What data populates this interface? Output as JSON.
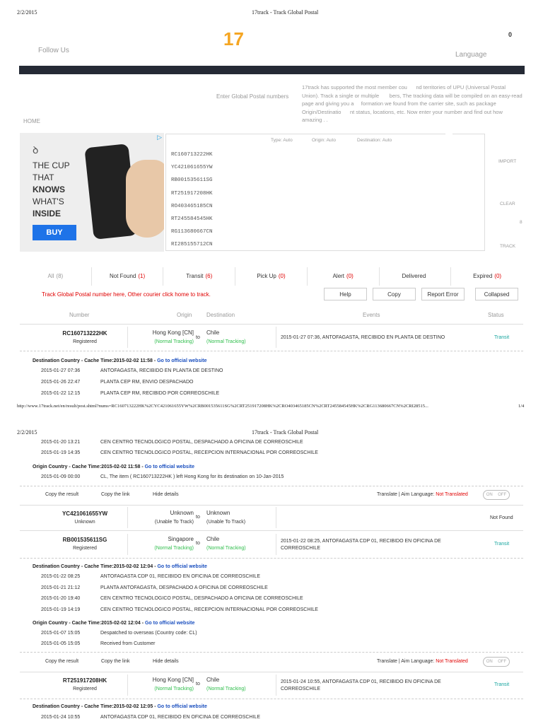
{
  "page1": {
    "print_date": "2/2/2015",
    "print_title": "17track - Track Global Postal",
    "follow_us": "Follow Us",
    "logo": "17",
    "cart_count": "0",
    "language": "Language",
    "home": "HOME",
    "enter_label": "Enter Global Postal numbers",
    "intro": "17track has supported the most member cou      nd territories of UPU (Universal Postal Union). Track a single or multiple       bers, The tracking data will be compiled on an easy-read page and giving you a     formation we found from the carrier site, such as package Origin/Destinatio      nt status, locations, etc. Now enter your number and find out how amazing . .",
    "ad": {
      "line1": "THE CUP",
      "line2": "THAT",
      "line3": "KNOWS",
      "line4": "WHAT'S",
      "line5": "INSIDE",
      "buy": "BUY"
    },
    "input_meta": {
      "type": "Type: Auto",
      "origin": "Origin: Auto",
      "destination": "Destination: Auto"
    },
    "numbers": [
      "RC160713222HK",
      "YC421061655YW",
      "RB001535611SG",
      "RT251917208HK",
      "RO403465185CN",
      "RT245584545HK",
      "RG113680667CN",
      "RI285155712CN"
    ],
    "right_buttons": {
      "import": "IMPORT",
      "clear": "CLEAR",
      "count": "8",
      "track": "TRACK"
    },
    "tabs": [
      {
        "label": "All",
        "count": "(8)",
        "color": "#999999"
      },
      {
        "label": "Not Found",
        "count": "(1)",
        "color": "#e00000"
      },
      {
        "label": "Transit",
        "count": "(6)",
        "color": "#e00000"
      },
      {
        "label": "Pick Up",
        "count": "(0)",
        "color": "#e00000"
      },
      {
        "label": "Alert",
        "count": "(0)",
        "color": "#e00000"
      },
      {
        "label": "Delivered",
        "count": "",
        "color": "#e00000"
      },
      {
        "label": "Expired",
        "count": "(0)",
        "color": "#e00000"
      }
    ],
    "notice": "Track Global Postal number here, Other courier click home to track.",
    "action_buttons": {
      "help": "Help",
      "copy": "Copy",
      "report": "Report Error",
      "collapsed": "Collapsed"
    },
    "columns": {
      "number": "Number",
      "origin": "Origin",
      "destination": "Destination",
      "events": "Events",
      "status": "Status"
    },
    "row1": {
      "number": "RC160713222HK",
      "sub": "Registered",
      "origin": "Hong Kong [CN]",
      "origin_sub": "(Normal Tracking)",
      "to": "to",
      "dest": "Chile",
      "dest_sub": "(Normal Tracking)",
      "event": "2015-01-27 07:36, ANTOFAGASTA, RECIBIDO EN PLANTA DE DESTINO",
      "status": "Transit"
    },
    "dest_head": "Destination Country - Cache Time:2015-02-02 11:58 - ",
    "official": "Go to official website",
    "events": [
      {
        "time": "2015-01-27 07:36",
        "text": "ANTOFAGASTA, RECIBIDO EN PLANTA DE DESTINO"
      },
      {
        "time": "2015-01-26 22:47",
        "text": "PLANTA CEP RM, ENVIO DESPACHADO"
      },
      {
        "time": "2015-01-22 12:15",
        "text": "PLANTA CEP RM, RECIBIDO POR CORREOSCHILE"
      }
    ],
    "footer_url": "http://www.17track.net/en/result/post.shtml?nums=RC160713222HK%2CYC421061655YW%2CRB001535611SG%2CRT251917208HK%2CRO403465185CN%2CRT245584545HK%2CRG113680667CN%2CRI28515...",
    "footer_page": "1/4"
  },
  "page2": {
    "print_date": "2/2/2015",
    "print_title": "17track - Track Global Postal",
    "cont_events": [
      {
        "time": "2015-01-20 13:21",
        "text": "CEN CENTRO TECNOLOGICO POSTAL, DESPACHADO A OFICINA DE CORREOSCHILE"
      },
      {
        "time": "2015-01-19 14:35",
        "text": "CEN CENTRO TECNOLOGICO POSTAL, RECEPCION INTERNACIONAL POR CORREOSCHILE"
      }
    ],
    "origin_head": "Origin Country - Cache Time:2015-02-02 11:58 - ",
    "official": "Go to official website",
    "origin_events": [
      {
        "time": "2015-01-09 00:00",
        "text": "CL, The item ( RC160713222HK ) left Hong Kong for its destination on 10-Jan-2015"
      }
    ],
    "links": {
      "copy_result": "Copy the result",
      "copy_link": "Copy the link",
      "hide": "Hide details",
      "translate": "Translate | Aim Language: ",
      "not_translated": "Not Translated",
      "on": "ON",
      "off": "OFF"
    },
    "row2": {
      "number": "YC421061655YW",
      "sub": "Unknown",
      "origin": "Unknown",
      "origin_sub": "(Unable To Track)",
      "to": "to",
      "dest": "Unknown",
      "dest_sub": "(Unable To Track)",
      "status": "Not Found"
    },
    "row3": {
      "number": "RB001535611SG",
      "sub": "Registered",
      "origin": "Singapore",
      "origin_sub": "(Normal Tracking)",
      "to": "to",
      "dest": "Chile",
      "dest_sub": "(Normal Tracking)",
      "event_l1": "2015-01-22 08:25, ANTOFAGASTA CDP 01, RECIBIDO EN OFICINA DE",
      "event_l2": "CORREOSCHILE",
      "status": "Transit"
    },
    "dest_head3": "Destination Country - Cache Time:2015-02-02 12:04 - ",
    "events3": [
      {
        "time": "2015-01-22 08:25",
        "text": "ANTOFAGASTA CDP 01, RECIBIDO EN OFICINA DE CORREOSCHILE"
      },
      {
        "time": "2015-01-21 21:12",
        "text": "PLANTA ANTOFAGASTA, DESPACHADO A OFICINA DE CORREOSCHILE"
      },
      {
        "time": "2015-01-20 19:40",
        "text": "CEN CENTRO TECNOLOGICO POSTAL, DESPACHADO A OFICINA DE CORREOSCHILE"
      },
      {
        "time": "2015-01-19 14:19",
        "text": "CEN CENTRO TECNOLOGICO POSTAL, RECEPCION INTERNACIONAL POR CORREOSCHILE"
      }
    ],
    "origin_head3": "Origin Country - Cache Time:2015-02-02 12:04 - ",
    "origin_events3": [
      {
        "time": "2015-01-07 15:05",
        "text": "Despatched to overseas (Country code: CL)"
      },
      {
        "time": "2015-01-05 15:05",
        "text": "Received from Customer"
      }
    ],
    "row4": {
      "number": "RT251917208HK",
      "sub": "Registered",
      "origin": "Hong Kong [CN]",
      "origin_sub": "(Normal Tracking)",
      "to": "to",
      "dest": "Chile",
      "dest_sub": "(Normal Tracking)",
      "event_l1": "2015-01-24 10:55, ANTOFAGASTA CDP 01, RECIBIDO EN OFICINA DE",
      "event_l2": "CORREOSCHILE",
      "status": "Transit"
    },
    "dest_head4": "Destination Country - Cache Time:2015-02-02 12:05 - ",
    "events4": [
      {
        "time": "2015-01-24 10:55",
        "text": "ANTOFAGASTA CDP 01, RECIBIDO EN OFICINA DE CORREOSCHILE"
      }
    ]
  }
}
